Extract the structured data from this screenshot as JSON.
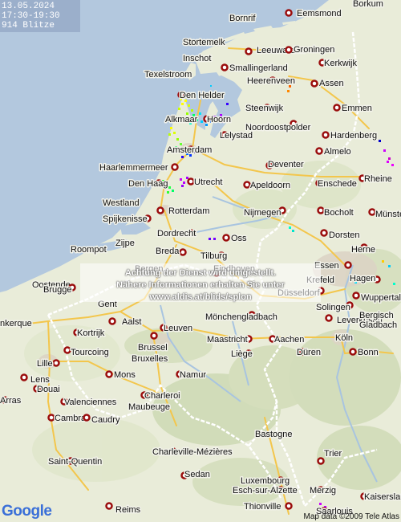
{
  "info": {
    "date": "13.05.2024",
    "time_range": "17:30-19:30",
    "strike_count": "914 Blitze"
  },
  "notice": {
    "line1": "Achtung der Dienst wird umgestellt.",
    "line2": "Nähere Informationen erhalten Sie unter",
    "line3": "www.aldis.at/blids/splon"
  },
  "attribution": {
    "logo_text": "Google",
    "copyright": "Map data ©2009 Tele Atlas"
  },
  "colors": {
    "water": "#b3c8de",
    "land": "#e9ecd9",
    "border": "#ffffff",
    "road": "#f3c64c",
    "city_dot_fill": "#ffffff",
    "city_dot_stroke": "#9a0c0c"
  },
  "cities": [
    {
      "name": "Bornrif"
    },
    {
      "name": "Eemsmond"
    },
    {
      "name": "Borkum"
    },
    {
      "name": "Stortemelk"
    },
    {
      "name": "Leeuwarden"
    },
    {
      "name": "Groningen"
    },
    {
      "name": "Kerkwijk"
    },
    {
      "name": "Inschot"
    },
    {
      "name": "Smallingerland"
    },
    {
      "name": "Texelstroom"
    },
    {
      "name": "Heerenveen"
    },
    {
      "name": "Assen"
    },
    {
      "name": "Den Helder"
    },
    {
      "name": "Steenwijk"
    },
    {
      "name": "Emmen"
    },
    {
      "name": "Alkmaar"
    },
    {
      "name": "Hoorn"
    },
    {
      "name": "Noordoostpolder"
    },
    {
      "name": "Lelystad"
    },
    {
      "name": "Hardenberg"
    },
    {
      "name": "Amsterdam"
    },
    {
      "name": "Almelo"
    },
    {
      "name": "Haarlemmermeer"
    },
    {
      "name": "Deventer"
    },
    {
      "name": "Rheine"
    },
    {
      "name": "Den Haag"
    },
    {
      "name": "Utrecht"
    },
    {
      "name": "Apeldoorn"
    },
    {
      "name": "Enschede"
    },
    {
      "name": "Westland"
    },
    {
      "name": "Rotterdam"
    },
    {
      "name": "Nijmegen"
    },
    {
      "name": "Bocholt"
    },
    {
      "name": "Münster"
    },
    {
      "name": "Spijkenisse"
    },
    {
      "name": "Dordrecht"
    },
    {
      "name": "Dorsten"
    },
    {
      "name": "Roompot"
    },
    {
      "name": "Zijpe"
    },
    {
      "name": "Breda"
    },
    {
      "name": "Oss"
    },
    {
      "name": "Herne"
    },
    {
      "name": "Bergen"
    },
    {
      "name": "Tilburg"
    },
    {
      "name": "Essen"
    },
    {
      "name": "Eindhoven"
    },
    {
      "name": "Oostende"
    },
    {
      "name": "Krefeld"
    },
    {
      "name": "Hagen"
    },
    {
      "name": "Brugge"
    },
    {
      "name": "Düsseldorf"
    },
    {
      "name": "Gent"
    },
    {
      "name": "Wuppertal"
    },
    {
      "name": "nkerque"
    },
    {
      "name": "Aalst"
    },
    {
      "name": "Solingen"
    },
    {
      "name": "Kortrijk"
    },
    {
      "name": "Leverkusen"
    },
    {
      "name": "Bergisch"
    },
    {
      "name": "Gladbach"
    },
    {
      "name": "Leuven"
    },
    {
      "name": "Mönchengladbach"
    },
    {
      "name": "Tourcoing"
    },
    {
      "name": "Brussel"
    },
    {
      "name": "Bruxelles"
    },
    {
      "name": "Aachen"
    },
    {
      "name": "Köln"
    },
    {
      "name": "Maastricht"
    },
    {
      "name": "Lille"
    },
    {
      "name": "Liège"
    },
    {
      "name": "Düren"
    },
    {
      "name": "Bonn"
    },
    {
      "name": "Lens"
    },
    {
      "name": "Mons"
    },
    {
      "name": "Namur"
    },
    {
      "name": "Douai"
    },
    {
      "name": "Valenciennes"
    },
    {
      "name": "Charleroi"
    },
    {
      "name": "Arras"
    },
    {
      "name": "Maubeuge"
    },
    {
      "name": "Cambrai"
    },
    {
      "name": "Caudry"
    },
    {
      "name": "Bastogne"
    },
    {
      "name": "Saint-Quentin"
    },
    {
      "name": "Charleville-Mézières"
    },
    {
      "name": "Trier"
    },
    {
      "name": "Sedan"
    },
    {
      "name": "Luxembourg"
    },
    {
      "name": "Esch-sur-Alzette"
    },
    {
      "name": "Merzig"
    },
    {
      "name": "Reims"
    },
    {
      "name": "Thionville"
    },
    {
      "name": "Saarlouis"
    },
    {
      "name": "Kaiserslautern"
    }
  ]
}
